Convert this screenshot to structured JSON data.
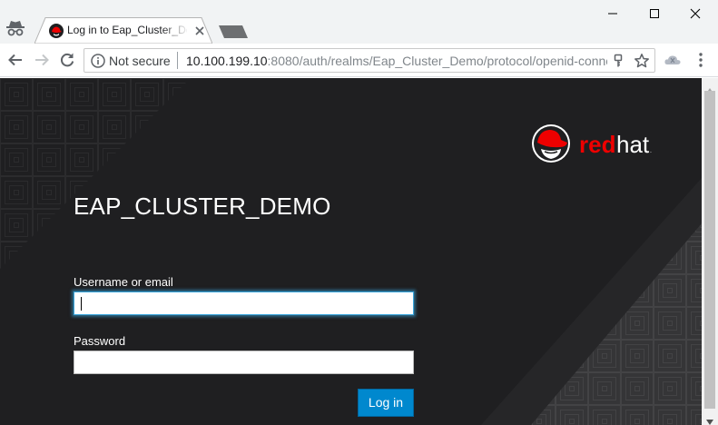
{
  "browser": {
    "tab": {
      "title": "Log in to Eap_Cluster_Demo"
    },
    "address_bar": {
      "security_label": "Not secure",
      "url_host": "10.100.199.10",
      "url_rest": ":8080/auth/realms/Eap_Cluster_Demo/protocol/openid-conne"
    },
    "icons": {
      "incognito": "incognito-icon",
      "back": "back-arrow-icon",
      "forward": "forward-arrow-icon",
      "reload": "reload-icon",
      "info": "info-icon",
      "key": "key-icon",
      "star": "star-icon",
      "extension": "cloud-extension-icon",
      "menu": "three-dots-menu-icon"
    },
    "window_controls": [
      "minimize",
      "maximize",
      "close"
    ]
  },
  "page": {
    "brand": {
      "logo_text": "redhat"
    },
    "realm_title": "EAP_CLUSTER_DEMO",
    "form": {
      "username_label": "Username or email",
      "username_value": "",
      "password_label": "Password",
      "password_value": "",
      "submit_label": "Log in"
    }
  },
  "colors": {
    "page_background": "#1f1f21",
    "button_primary": "#0088ce",
    "focus_ring": "#39a5dc",
    "brand_red": "#ee0000"
  }
}
